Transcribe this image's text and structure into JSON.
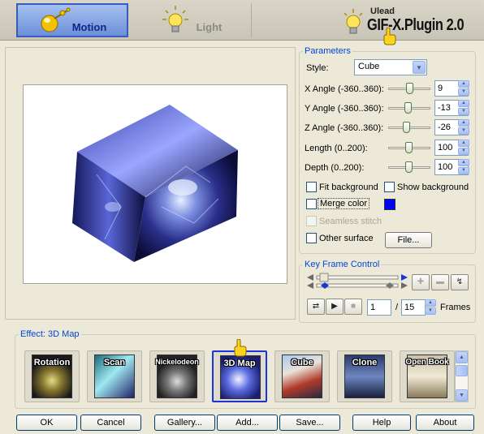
{
  "tabs": {
    "motion": "Motion",
    "light": "Light"
  },
  "brand": {
    "maker": "Ulead",
    "title": "GIF-X.Plugin 2.0"
  },
  "parameters": {
    "title": "Parameters",
    "style_label": "Style:",
    "style_value": "Cube",
    "rows": [
      {
        "label": "X Angle (-360..360):",
        "value": "9"
      },
      {
        "label": "Y Angle (-360..360):",
        "value": "-13"
      },
      {
        "label": "Z Angle (-360..360):",
        "value": "-26"
      },
      {
        "label": "Length (0..200):",
        "value": "100"
      },
      {
        "label": "Depth (0..200):",
        "value": "100"
      }
    ],
    "fit_background": "Fit background",
    "show_background": "Show background",
    "merge_color": "Merge color",
    "merge_color_swatch": "#0000ff",
    "seamless_stitch": "Seamless stitch",
    "other_surface": "Other surface",
    "file_button": "File..."
  },
  "keyframe": {
    "title": "Key Frame Control",
    "current_frame": "1",
    "separator": "/",
    "total_frames": "15",
    "frames_label": "Frames"
  },
  "effect": {
    "title": "Effect: 3D Map",
    "thumbnails": [
      "Rotation",
      "Scan",
      "Nickelodeon",
      "3D Map",
      "Cube",
      "Clone",
      "Open Book"
    ]
  },
  "buttons": {
    "ok": "OK",
    "cancel": "Cancel",
    "gallery": "Gallery...",
    "add": "Add...",
    "save": "Save...",
    "help": "Help",
    "about": "About"
  },
  "colors": {
    "accent": "#0046d5",
    "selected_border": "#1b35d4",
    "merge_color": "#0000ff"
  }
}
